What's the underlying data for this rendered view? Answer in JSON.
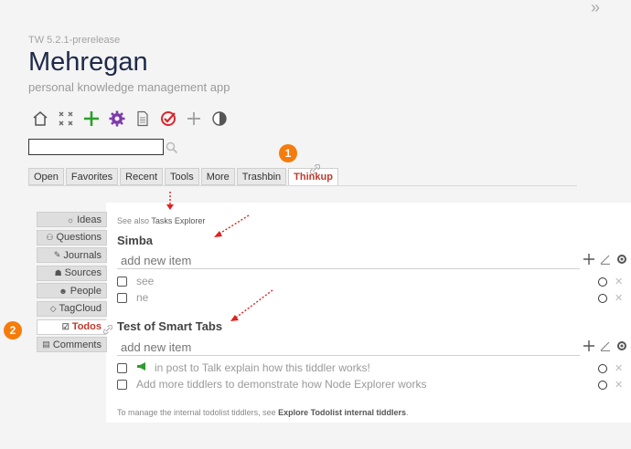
{
  "header": {
    "version": "TW 5.2.1-prerelease",
    "title": "Mehregan",
    "subtitle": "personal knowledge management app",
    "chevron": "»"
  },
  "toolbar": {
    "icons": [
      "home-icon",
      "close-all-icon",
      "new-tiddler-icon",
      "control-panel-icon",
      "page-icon",
      "todo-check-icon",
      "import-icon",
      "theme-icon"
    ],
    "colors": {
      "new": "#2e9d2e",
      "settings": "#7c3aa8",
      "check": "#d9262e"
    }
  },
  "search": {
    "value": "",
    "placeholder": ""
  },
  "badges": {
    "one": "1",
    "two": "2",
    "color": "#f57c0c"
  },
  "tabs": {
    "items": [
      "Open",
      "Favorites",
      "Recent",
      "Tools",
      "More",
      "Trashbin",
      "Thinkup"
    ],
    "active": "Thinkup"
  },
  "sidebar": {
    "items": [
      "Ideas",
      "Questions",
      "Journals",
      "Sources",
      "People",
      "TagCloud",
      "Todos",
      "Comments"
    ],
    "active": "Todos"
  },
  "content": {
    "see_also_prefix": "See also",
    "see_also_link": "Tasks Explorer",
    "sections": [
      {
        "title": "Simba",
        "add_placeholder": "add new item",
        "items": [
          "see",
          "ne"
        ]
      },
      {
        "title": "Test of Smart Tabs",
        "add_placeholder": "add new item",
        "items": [
          "in post to Talk explain how this tiddler works!",
          "Add more tiddlers to demonstrate how Node Explorer works"
        ]
      }
    ],
    "footer_prefix": "To manage the internal todolist tiddlers, see",
    "footer_link": "Explore Todolist internal tiddlers",
    "footer_suffix": "."
  }
}
